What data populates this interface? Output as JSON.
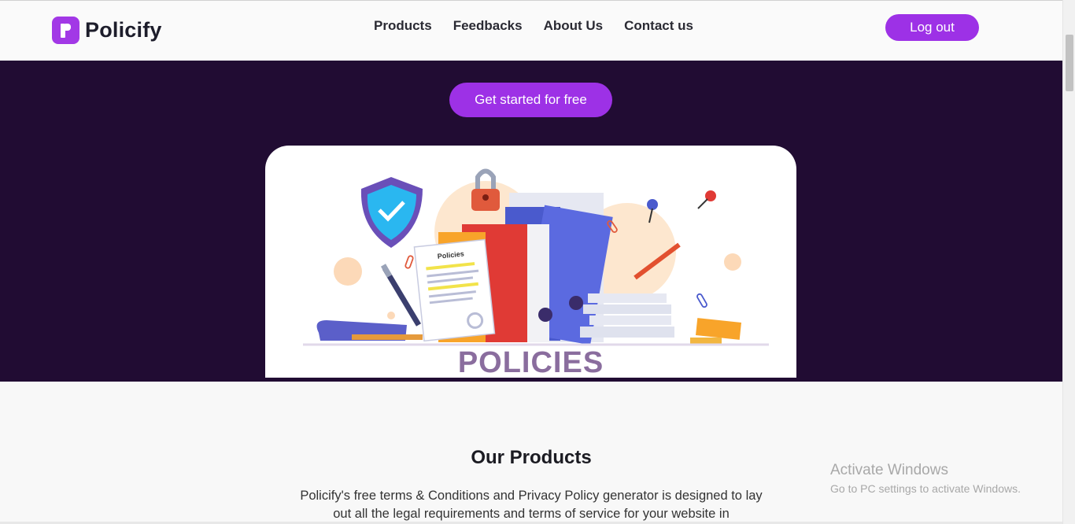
{
  "brand": {
    "name": "Policify",
    "logo_icon": "policify-logo-icon",
    "accent": "#9d31e6",
    "hero_bg": "#210c33"
  },
  "nav": {
    "items": [
      "Products",
      "Feedbacks",
      "About Us",
      "Contact us"
    ]
  },
  "header": {
    "logout_label": "Log out"
  },
  "hero": {
    "cta_label": "Get started for free",
    "illustration_title": "POLICIES",
    "document_label": "Policies"
  },
  "products": {
    "heading": "Our Products",
    "description": "Policify's free terms & Conditions and Privacy Policy generator is designed to lay out all the legal requirements and terms of service for your website in"
  },
  "os_watermark": {
    "line1": "Activate Windows",
    "line2": "Go to PC settings to activate Windows."
  }
}
